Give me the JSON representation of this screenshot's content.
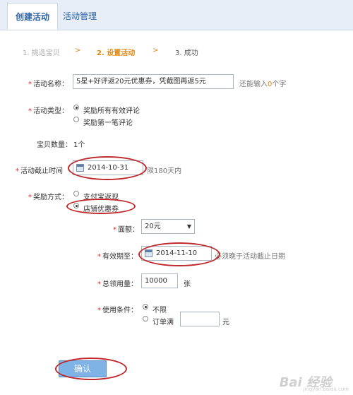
{
  "tabs": {
    "create": "创建活动",
    "manage": "活动管理"
  },
  "steps": {
    "step1": "1. 挑选宝贝",
    "arrow": ">",
    "step2": "2. 设置活动",
    "step3": "3. 成功"
  },
  "form": {
    "name_label": "活动名称：",
    "name_value": "5星+好评返20元优惠券，凭截图再返5元",
    "name_hint_prefix": "还能输入",
    "name_hint_count": "0",
    "name_hint_suffix": "个字",
    "type_label": "活动类型：",
    "type_opt1": "奖励所有有效评论",
    "type_opt2": "奖励第一笔评论",
    "count_label": "宝贝数量：",
    "count_value": "1个",
    "deadline_label": "活动截止时间",
    "deadline_value": "2014-10-31",
    "deadline_hint": "限180天内",
    "reward_label": "奖励方式：",
    "reward_opt1": "支付宝返现",
    "reward_opt2": "店铺优惠券",
    "amount_label": "面额：",
    "amount_value": "20元",
    "valid_label": "有效期至：",
    "valid_value": "2014-11-10",
    "valid_hint": "必须晚于活动截止日期",
    "total_label": "总领用量：",
    "total_value": "10000",
    "total_unit": "张",
    "cond_label": "使用条件：",
    "cond_opt1": "不限",
    "cond_opt2": "订单满",
    "cond_unit": "元",
    "confirm": "确认"
  },
  "watermark": {
    "main": "Bai 经验",
    "sub": "jingyan.baidu.com"
  },
  "colors": {
    "accent": "#e0870f",
    "link": "#2a62a6",
    "annotation": "#c0282b",
    "button": "#7fb2e5"
  }
}
